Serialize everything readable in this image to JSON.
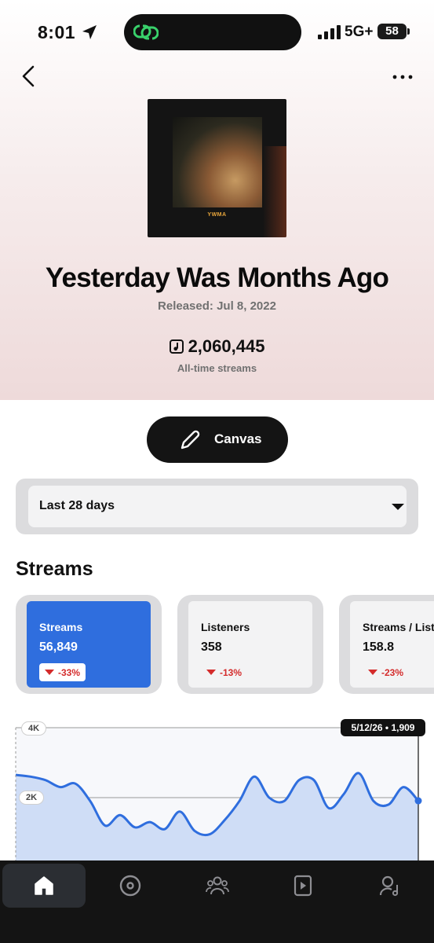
{
  "status_bar": {
    "time": "8:01",
    "network": "5G+",
    "battery": "58"
  },
  "release": {
    "title": "Yesterday Was Months Ago",
    "released": "Released: Jul 8, 2022",
    "streams": "2,060,445",
    "streams_caption": "All-time streams",
    "art_label": "YWMA"
  },
  "canvas_button": {
    "label": "Canvas"
  },
  "period_select": {
    "value": "Last 28 days"
  },
  "section": {
    "title": "Streams"
  },
  "cards": [
    {
      "label": "Streams",
      "value": "56,849",
      "change": "-33%",
      "active": true
    },
    {
      "label": "Listeners",
      "value": "358",
      "change": "-13%",
      "active": false
    },
    {
      "label": "Streams / Listener",
      "value": "158.8",
      "change": "-23%",
      "active": false
    }
  ],
  "chart": {
    "tooltip": "5/12/26 • 1,909",
    "y_ticks": [
      "4K",
      "2K"
    ],
    "accent": "#2f6ede"
  },
  "chart_data": {
    "type": "area",
    "y_ticks": [
      "4K",
      "2K"
    ],
    "ylim": [
      0,
      4000
    ],
    "series": [
      {
        "values": [
          2650,
          2600,
          2500,
          2300,
          2400,
          1900,
          1200,
          1500,
          1150,
          1300,
          1100,
          1600,
          1050,
          950,
          1350,
          1900,
          2600,
          2000,
          1900,
          2500,
          2500,
          1700,
          2100,
          2700,
          1900,
          1800,
          2300,
          1909
        ]
      }
    ],
    "highlight": {
      "date": "5/12/26",
      "value": 1909
    }
  },
  "tab_bar": {
    "tabs": [
      {
        "name": "home",
        "icon": "home-icon",
        "active": true
      },
      {
        "name": "releases",
        "icon": "disc-icon",
        "active": false
      },
      {
        "name": "audience",
        "icon": "people-icon",
        "active": false
      },
      {
        "name": "video",
        "icon": "play-square-icon",
        "active": false
      },
      {
        "name": "profile",
        "icon": "artist-icon",
        "active": false
      }
    ]
  }
}
